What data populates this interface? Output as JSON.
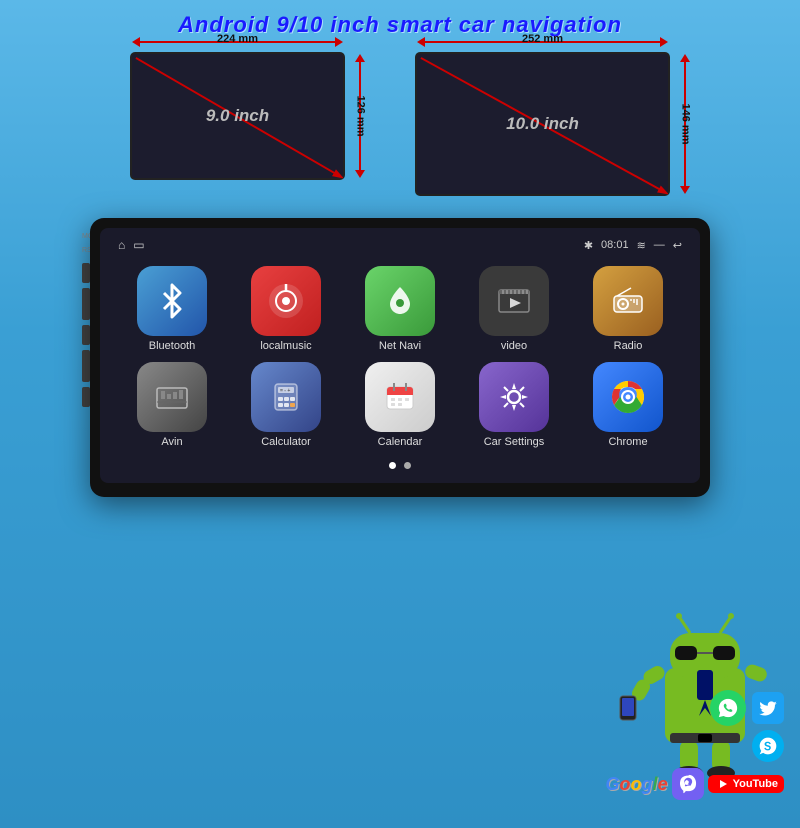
{
  "title": "Android 9/10 inch smart car navigation",
  "diagram": {
    "device9": {
      "label": "9.0 inch",
      "width_mm": "224 mm",
      "height_mm": "126 mm"
    },
    "device10": {
      "label": "10.0 inch",
      "width_mm": "252 mm",
      "height_mm": "146 mm"
    }
  },
  "statusBar": {
    "time": "08:01",
    "bluetooth_icon": "✱",
    "home_icon": "⌂",
    "minimize_icon": "—",
    "back_icon": "←",
    "signal_icon": "≋"
  },
  "apps": [
    {
      "id": "bluetooth",
      "label": "Bluetooth",
      "bg": "bg-bluetooth",
      "icon": "bluetooth"
    },
    {
      "id": "localmusic",
      "label": "localmusic",
      "bg": "bg-localmusic",
      "icon": "music"
    },
    {
      "id": "netnavi",
      "label": "Net Navi",
      "bg": "bg-netnavi",
      "icon": "map"
    },
    {
      "id": "video",
      "label": "video",
      "bg": "bg-video",
      "icon": "film"
    },
    {
      "id": "radio",
      "label": "Radio",
      "bg": "bg-radio",
      "icon": "radio"
    },
    {
      "id": "avin",
      "label": "Avin",
      "bg": "bg-avin",
      "icon": "avin"
    },
    {
      "id": "calculator",
      "label": "Calculator",
      "bg": "bg-calculator",
      "icon": "calc"
    },
    {
      "id": "calendar",
      "label": "Calendar",
      "bg": "bg-calendar",
      "icon": "cal"
    },
    {
      "id": "carsettings",
      "label": "Car Settings",
      "bg": "bg-carsettings",
      "icon": "gear"
    },
    {
      "id": "chrome",
      "label": "Chrome",
      "bg": "bg-chrome",
      "icon": "chrome"
    }
  ],
  "dots": [
    {
      "active": true
    },
    {
      "active": false
    }
  ]
}
